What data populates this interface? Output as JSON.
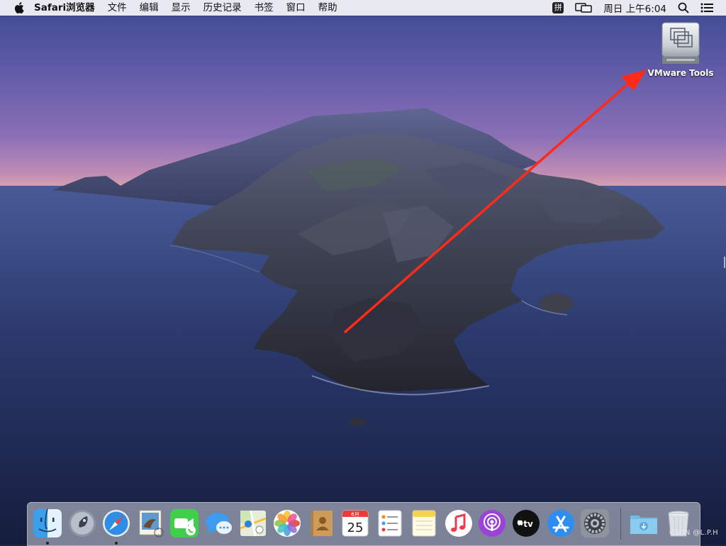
{
  "menubar": {
    "app_name": "Safari浏览器",
    "items": [
      "文件",
      "编辑",
      "显示",
      "历史记录",
      "书签",
      "窗口",
      "帮助"
    ],
    "input_method": "拼",
    "clock": "周日 上午6:04"
  },
  "desktop": {
    "icons": [
      {
        "label": "VMware Tools",
        "icon": "drive-icon"
      }
    ],
    "annotation_color": "#ff2a1a"
  },
  "dock": {
    "apps": [
      {
        "name": "finder",
        "running": true
      },
      {
        "name": "launchpad",
        "running": false
      },
      {
        "name": "safari",
        "running": true
      },
      {
        "name": "mail",
        "running": false
      },
      {
        "name": "facetime",
        "running": false
      },
      {
        "name": "messages",
        "running": false
      },
      {
        "name": "maps",
        "running": false
      },
      {
        "name": "photos",
        "running": false
      },
      {
        "name": "contacts",
        "running": false
      },
      {
        "name": "calendar",
        "running": false,
        "month": "6月",
        "day": "25"
      },
      {
        "name": "reminders",
        "running": false
      },
      {
        "name": "notes",
        "running": false
      },
      {
        "name": "music",
        "running": false
      },
      {
        "name": "podcasts",
        "running": false
      },
      {
        "name": "apple-tv",
        "running": false,
        "label": "tv"
      },
      {
        "name": "app-store",
        "running": false
      },
      {
        "name": "system-preferences",
        "running": false
      },
      {
        "name": "downloads",
        "running": false
      },
      {
        "name": "trash",
        "running": false
      }
    ]
  },
  "watermark": "CSDN @L.P.H"
}
